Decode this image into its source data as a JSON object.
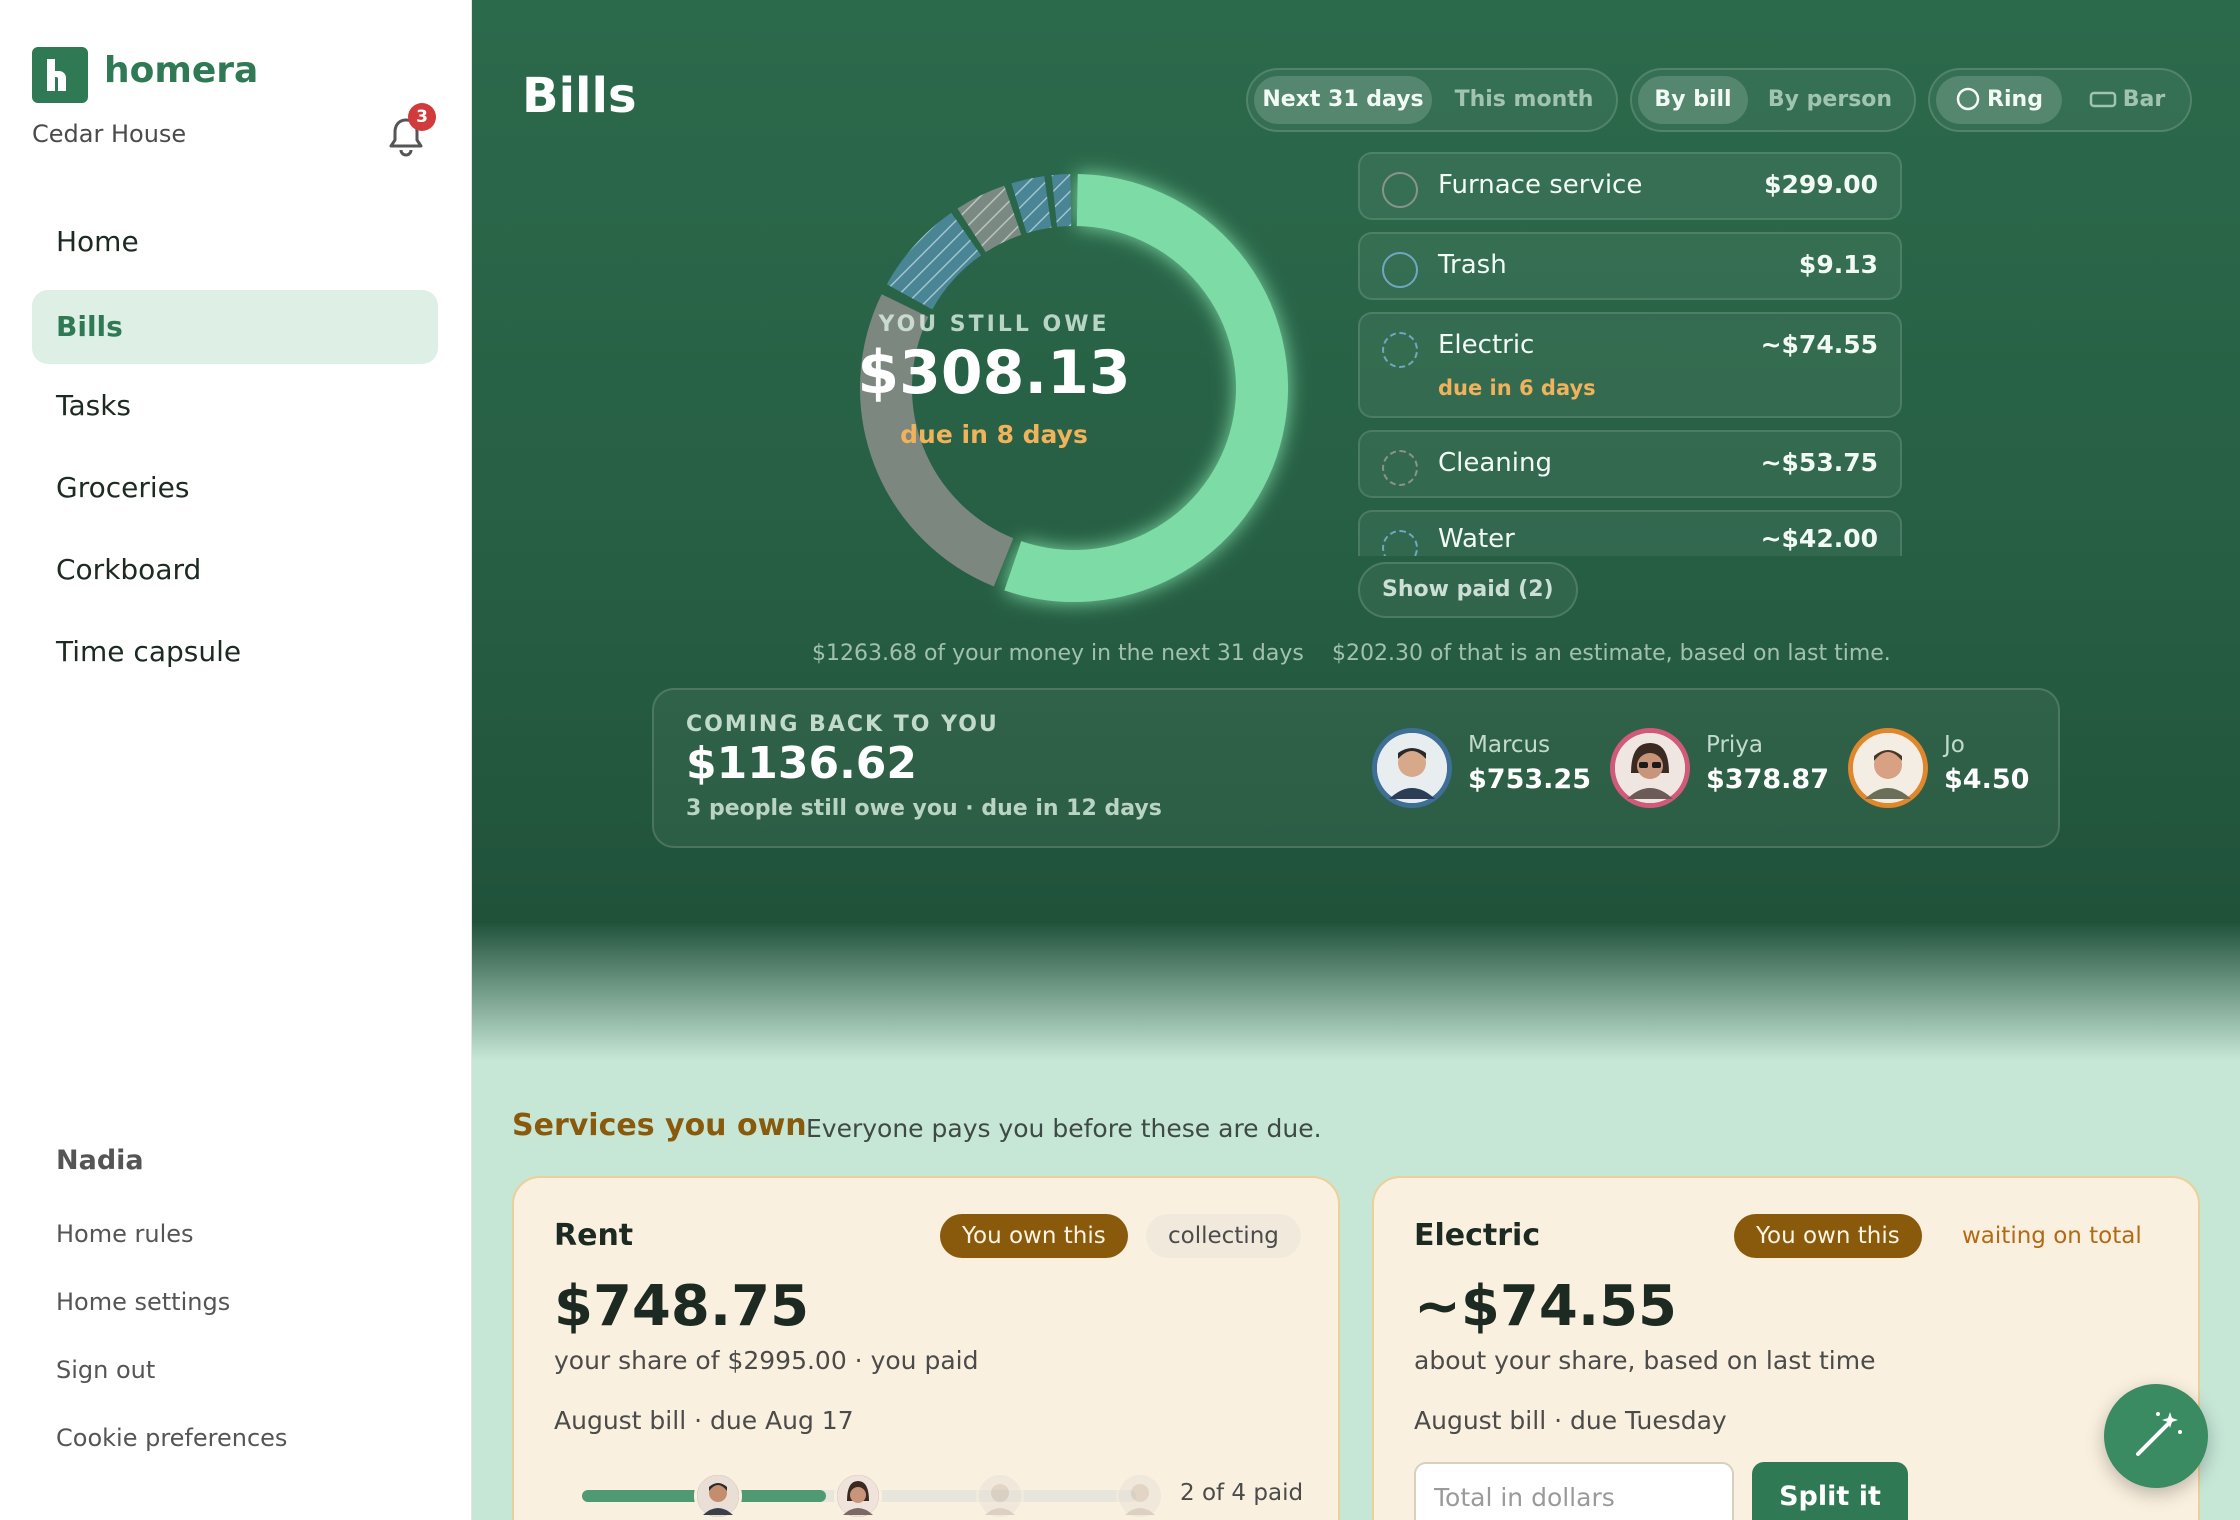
{
  "app": {
    "name": "homera",
    "home_name": "Cedar House",
    "notifications_count": "3"
  },
  "nav": [
    {
      "label": "Home",
      "active": false
    },
    {
      "label": "Bills",
      "active": true
    },
    {
      "label": "Tasks",
      "active": false
    },
    {
      "label": "Groceries",
      "active": false
    },
    {
      "label": "Corkboard",
      "active": false
    },
    {
      "label": "Time capsule",
      "active": false
    }
  ],
  "user": {
    "name": "Nadia",
    "links": [
      "Home rules",
      "Home settings",
      "Sign out",
      "Cookie preferences"
    ]
  },
  "page": {
    "title": "Bills"
  },
  "filters": {
    "period": {
      "options": [
        "Next 31 days",
        "This month"
      ],
      "selected": "Next 31 days"
    },
    "grouping": {
      "options": [
        "By bill",
        "By person"
      ],
      "selected": "By bill"
    },
    "view": {
      "options": [
        "Ring",
        "Bar"
      ],
      "selected": "Ring"
    }
  },
  "summary": {
    "label": "YOU STILL OWE",
    "amount": "$308.13",
    "due": "due in 8 days",
    "footnote_total": "$1263.68 of your money in the next 31 days",
    "footnote_estimate": "$202.30 of that is an estimate, based on last time."
  },
  "ring": {
    "colors": {
      "paid": "#7ddba6",
      "owed": "#7c877f",
      "estimate_a": "#4a8596",
      "estimate_b": "#7a8a82",
      "track": "#1f4f39"
    },
    "paid_fraction": 0.5
  },
  "bills": [
    {
      "name": "Furnace service",
      "amount": "$299.00",
      "sub": "",
      "check": "solid-grey"
    },
    {
      "name": "Trash",
      "amount": "$9.13",
      "sub": "",
      "check": "solid-blue"
    },
    {
      "name": "Electric",
      "amount": "~$74.55",
      "sub": "due in 6 days",
      "check": "dashed-blue"
    },
    {
      "name": "Cleaning",
      "amount": "~$53.75",
      "sub": "",
      "check": "dashed-grey"
    },
    {
      "name": "Water",
      "amount": "~$42.00",
      "sub": "",
      "check": "dashed-blue"
    }
  ],
  "show_paid_label": "Show paid (2)",
  "coming_back": {
    "label": "COMING BACK TO YOU",
    "amount": "$1136.62",
    "sub": "3 people still owe you · due in 12 days",
    "people": [
      {
        "name": "Marcus",
        "amount": "$753.25",
        "ring_color": "#3f6f96"
      },
      {
        "name": "Priya",
        "amount": "$378.87",
        "ring_color": "#d05a78"
      },
      {
        "name": "Jo",
        "amount": "$4.50",
        "ring_color": "#e0862b"
      }
    ]
  },
  "services": {
    "title": "Services you own",
    "subtitle": "Everyone pays you before these are due.",
    "cards": [
      {
        "title": "Rent",
        "badge_own": "You own this",
        "status": "collecting",
        "amount": "$748.75",
        "share_text": "your share of $2995.00 · you paid",
        "due_text": "August bill · due Aug 17",
        "paid_text": "2 of 4 paid",
        "paid_fraction": 0.5
      },
      {
        "title": "Electric",
        "badge_own": "You own this",
        "status": "waiting on total",
        "amount": "~$74.55",
        "share_text": "about your share, based on last time",
        "due_text": "August bill · due Tuesday",
        "input_placeholder": "Total in dollars",
        "button_label": "Split it"
      }
    ]
  }
}
